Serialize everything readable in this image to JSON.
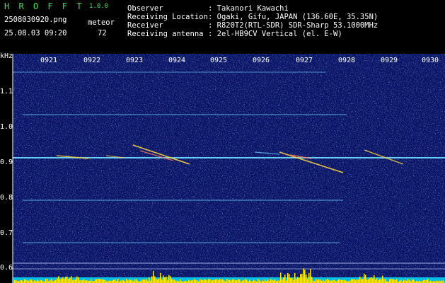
{
  "header": {
    "app_name": "H R O F F T",
    "version": "1.0.0",
    "filename": "2508030920.png",
    "meteor_label": "meteor",
    "timestamp": "25.08.03 09:20",
    "meteor_count": "72",
    "fields": [
      {
        "label": "Observer",
        "value": ": Takanori Kawachi"
      },
      {
        "label": "Receiving Location",
        "value": ": Ogaki, Gifu, JAPAN (136.60E, 35.35N)"
      },
      {
        "label": "Receiver",
        "value": ": R820T2(RTL-SDR) SDR-Sharp 53.1000MHz"
      },
      {
        "label": "Receiving antenna",
        "value": ": 2el-HB9CV Vertical (el. E-W)"
      }
    ]
  },
  "spectrogram": {
    "y_unit": "kHz",
    "time_ticks": [
      "0921",
      "0922",
      "0923",
      "0924",
      "0925",
      "0926",
      "0927",
      "0928",
      "0929",
      "0930"
    ],
    "freq_ticks": [
      "1.1",
      "1.0",
      "0.9",
      "0.8",
      "0.7",
      "0.6"
    ],
    "colors": {
      "background": "#0a1466",
      "carrier": "#6fd8ff",
      "meteor": "#ffd23a",
      "amplitude_bar": "#ffee00",
      "baseline": "#00bfe6"
    }
  }
}
